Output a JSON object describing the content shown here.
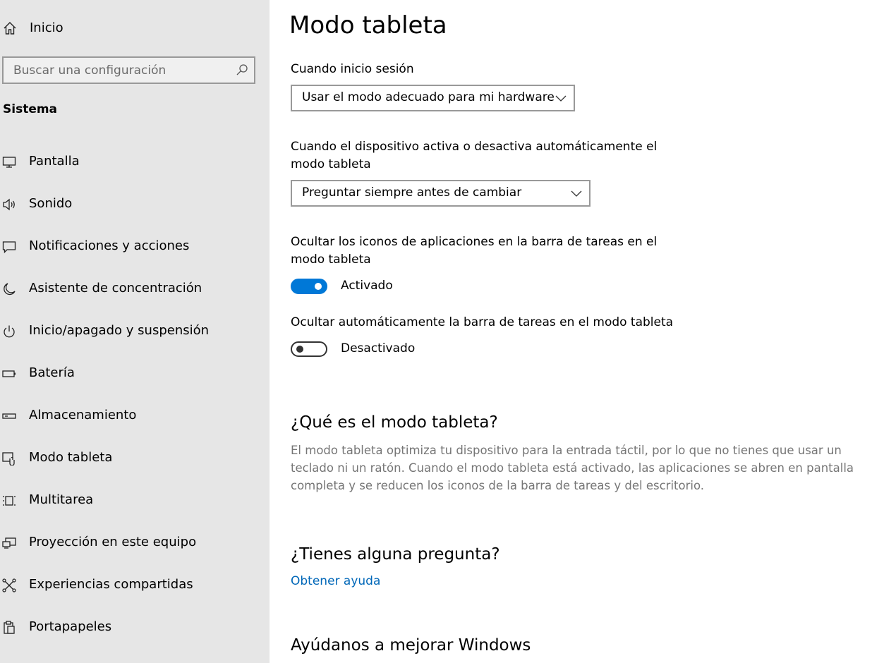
{
  "sidebar": {
    "home_label": "Inicio",
    "search_placeholder": "Buscar una configuración",
    "section_title": "Sistema",
    "items": [
      {
        "label": "Pantalla",
        "icon": "monitor-icon"
      },
      {
        "label": "Sonido",
        "icon": "speaker-icon"
      },
      {
        "label": "Notificaciones y acciones",
        "icon": "notification-icon"
      },
      {
        "label": "Asistente de concentración",
        "icon": "moon-icon"
      },
      {
        "label": "Inicio/apagado y suspensión",
        "icon": "power-icon"
      },
      {
        "label": "Batería",
        "icon": "battery-icon"
      },
      {
        "label": "Almacenamiento",
        "icon": "storage-icon"
      },
      {
        "label": "Modo tableta",
        "icon": "tablet-mode-icon"
      },
      {
        "label": "Multitarea",
        "icon": "multitasking-icon"
      },
      {
        "label": "Proyección en este equipo",
        "icon": "projection-icon"
      },
      {
        "label": "Experiencias compartidas",
        "icon": "shared-experiences-icon"
      },
      {
        "label": "Portapapeles",
        "icon": "clipboard-icon"
      }
    ]
  },
  "main": {
    "title": "Modo tableta",
    "signin_label": "Cuando inicio sesión",
    "signin_value": "Usar el modo adecuado para mi hardware",
    "auto_switch_label": "Cuando el dispositivo activa o desactiva automáticamente el modo tableta",
    "auto_switch_value": "Preguntar siempre antes de cambiar",
    "hide_icons_label": "Ocultar los iconos de aplicaciones en la barra de tareas en el modo tableta",
    "hide_icons_state": "Activado",
    "hide_icons_on": true,
    "autohide_taskbar_label": "Ocultar automáticamente la barra de tareas en el modo tableta",
    "autohide_taskbar_state": "Desactivado",
    "autohide_taskbar_on": false,
    "what_is_heading": "¿Qué es el modo tableta?",
    "what_is_text": "El modo tableta optimiza tu dispositivo para la entrada táctil, por lo que no tienes que usar un teclado ni un ratón. Cuando el modo tableta está activado, las aplicaciones se abren en pantalla completa y se reducen los iconos de la barra de tareas y del escritorio.",
    "question_heading": "¿Tienes alguna pregunta?",
    "help_link": "Obtener ayuda",
    "improve_heading": "Ayúdanos a mejorar Windows"
  },
  "colors": {
    "accent": "#0078d7",
    "link": "#0067b8",
    "sidebar_bg": "#e6e6e6",
    "secondary_text": "#767676"
  }
}
